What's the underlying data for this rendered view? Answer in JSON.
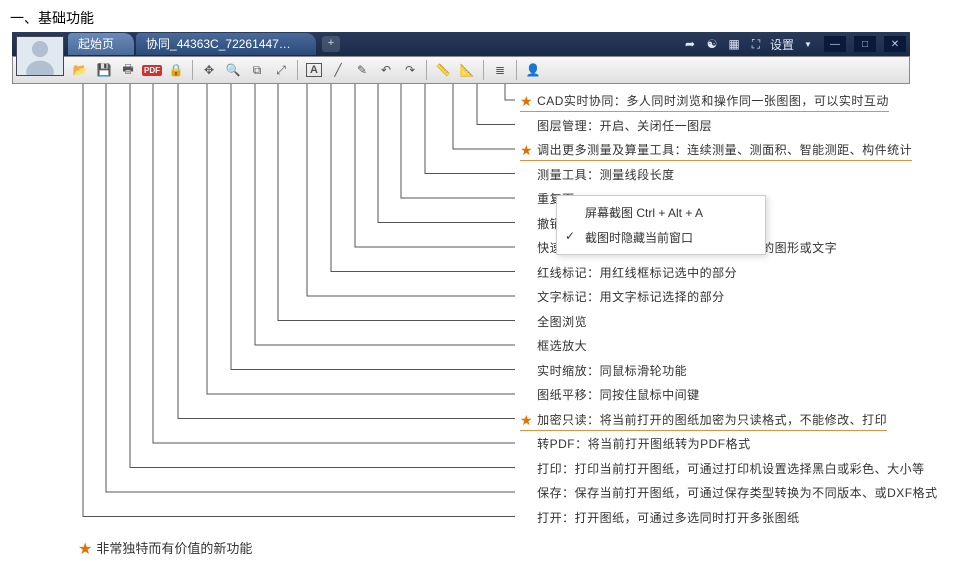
{
  "heading": "一、基础功能",
  "tabs": {
    "start": "起始页",
    "doc": "协同_44363C_722614477.d...",
    "add": "+"
  },
  "tabbar_right": {
    "share": "share-icon",
    "wechat": "wechat-icon",
    "grid": "grid-icon",
    "fullscreen": "fullscreen-icon",
    "settings_label": "设置",
    "settings_caret": "▼"
  },
  "winbuttons": {
    "min": "—",
    "max": "□",
    "close": "✕"
  },
  "toolbar_icons": [
    "open-icon",
    "save-icon",
    "print-icon",
    "pdf-icon",
    "lock-icon",
    "sep",
    "pan-icon",
    "zoom-realtime-icon",
    "zoom-window-icon",
    "zoom-all-icon",
    "sep",
    "text-mark-icon",
    "line-mark-icon",
    "pencil-icon",
    "undo-icon",
    "redo-icon",
    "sep",
    "measure-icon",
    "measure-tools-icon",
    "sep",
    "layers-icon",
    "sep",
    "collab-icon"
  ],
  "entries": [
    {
      "text": "CAD实时协同：多人同时浏览和操作同一张图图，可以实时互动",
      "star": true,
      "underline": true
    },
    {
      "text": "图层管理：开启、关闭任一图层",
      "star": false
    },
    {
      "text": "调出更多测量及算量工具：连续测量、测面积、智能测距、构件统计",
      "star": true,
      "underline": true
    },
    {
      "text": "测量工具：测量线段长度",
      "star": false
    },
    {
      "text": "重复下一………………………………",
      "star": false,
      "obscured": true
    },
    {
      "text": "撤销……",
      "star": false,
      "obscured": true
    },
    {
      "text": "快速删除：…………………………选中后的图形或文字",
      "star": false
    },
    {
      "text": "红线标记：用红线框标记选中的部分",
      "star": false
    },
    {
      "text": "文字标记：用文字标记选择的部分",
      "star": false
    },
    {
      "text": "全图浏览",
      "star": false
    },
    {
      "text": "框选放大",
      "star": false
    },
    {
      "text": "实时缩放：同鼠标滑轮功能",
      "star": false
    },
    {
      "text": "图纸平移：同按住鼠标中间键",
      "star": false
    },
    {
      "text": "加密只读：将当前打开的图纸加密为只读格式，不能修改、打印",
      "star": true,
      "underline": true
    },
    {
      "text": "转PDF：将当前打开图纸转为PDF格式",
      "star": false
    },
    {
      "text": "打印：打印当前打开图纸，可通过打印机设置选择黑白或彩色、大小等",
      "star": false
    },
    {
      "text": "保存：保存当前打开图纸，可通过保存类型转换为不同版本、或DXF格式",
      "star": false
    },
    {
      "text": "打开：打开图纸，可通过多选同时打开多张图纸",
      "star": false
    }
  ],
  "popup": {
    "item1": "屏幕截图 Ctrl + Alt + A",
    "item2": "截图时隐藏当前窗口"
  },
  "footnote": "非常独特而有价值的新功能",
  "entry_top_start": 16,
  "entry_spacing": 24.5,
  "toolbar_icon_xs": [
    83,
    106,
    130,
    153,
    178,
    207,
    231,
    255,
    278,
    307,
    331,
    355,
    378,
    401,
    425,
    453,
    477,
    505,
    533
  ]
}
